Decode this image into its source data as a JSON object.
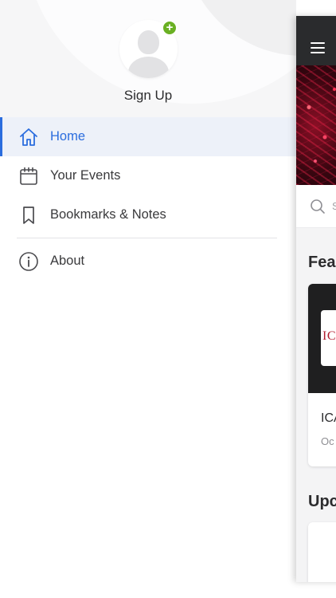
{
  "drawer": {
    "signup_label": "Sign Up",
    "menu": [
      {
        "label": "Home",
        "icon": "home-icon",
        "active": true
      },
      {
        "label": "Your Events",
        "icon": "calendar-icon",
        "active": false
      },
      {
        "label": "Bookmarks & Notes",
        "icon": "bookmark-icon",
        "active": false
      },
      {
        "label": "About",
        "icon": "info-icon",
        "active": false
      }
    ]
  },
  "app": {
    "search_placeholder": "S",
    "featured_title": "Fea",
    "featured_card": {
      "logo_text": "ICE",
      "title": "ICA",
      "subtitle": "Oc"
    },
    "upcoming_title": "Upc"
  },
  "colors": {
    "accent": "#2b6dde",
    "active_bg": "#edf1f9",
    "badge_green": "#6ab023",
    "topbar": "#2a2b2d"
  }
}
